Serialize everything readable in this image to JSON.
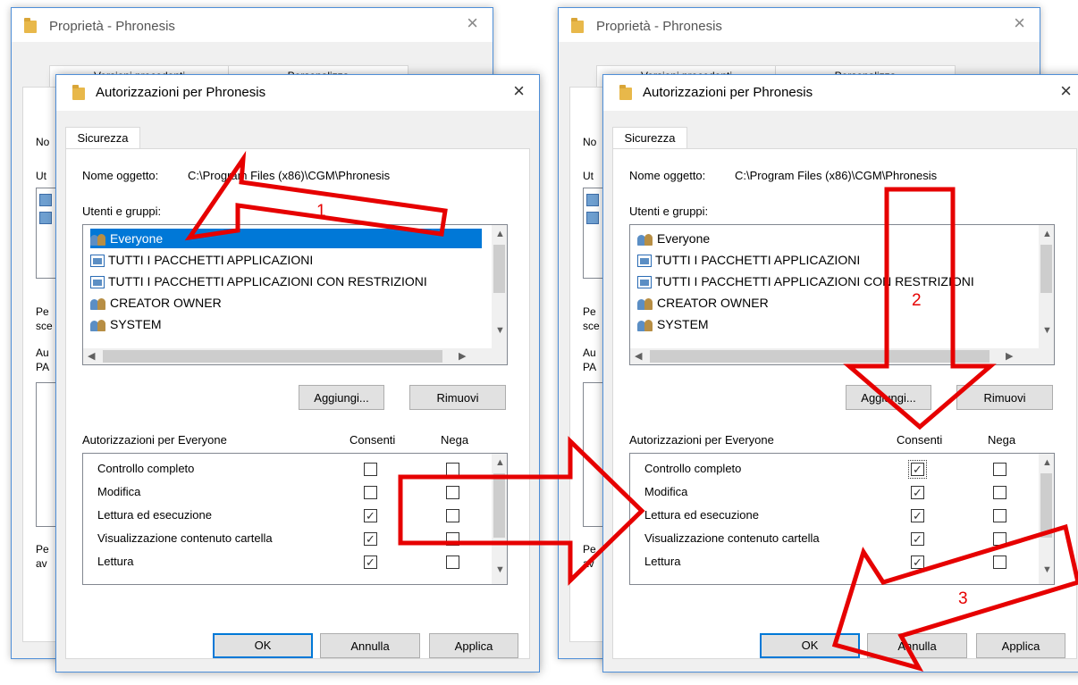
{
  "props_window": {
    "title": "Proprietà - Phronesis",
    "close_glyph": "×",
    "tab_left": "Versioni precedenti",
    "tab_right": "Personalizza",
    "fragments": {
      "nome": "No",
      "utenti": "Ut",
      "per1": "Pe",
      "per1b": "sce",
      "aut": "Au",
      "aut2": "PA",
      "per2": "Pe",
      "per2b": "av"
    }
  },
  "dialog": {
    "title": "Autorizzazioni per Phronesis",
    "close_glyph": "×",
    "tab": "Sicurezza",
    "object_label": "Nome oggetto:",
    "object_value": "C:\\Program Files (x86)\\CGM\\Phronesis",
    "groups_label": "Utenti e gruppi:",
    "users": [
      {
        "name": "Everyone",
        "icon": "people-icon"
      },
      {
        "name": "TUTTI I PACCHETTI APPLICAZIONI",
        "icon": "package-icon"
      },
      {
        "name": "TUTTI I PACCHETTI APPLICAZIONI CON RESTRIZIONI",
        "icon": "package-icon"
      },
      {
        "name": "CREATOR OWNER",
        "icon": "people-icon"
      },
      {
        "name": "SYSTEM",
        "icon": "people-icon"
      }
    ],
    "add_button": "Aggiungi...",
    "remove_button": "Rimuovi",
    "perm_title": "Autorizzazioni per Everyone",
    "allow_header": "Consenti",
    "deny_header": "Nega",
    "permissions": [
      "Controllo completo",
      "Modifica",
      "Lettura ed esecuzione",
      "Visualizzazione contenuto cartella",
      "Lettura"
    ],
    "ok_button": "OK",
    "cancel_button": "Annulla",
    "apply_button": "Applica"
  },
  "state_before": {
    "selected_user": "Everyone",
    "allow": [
      false,
      false,
      true,
      true,
      true
    ],
    "deny": [
      false,
      false,
      false,
      false,
      false
    ]
  },
  "state_after": {
    "selected_user": "",
    "allow": [
      true,
      true,
      true,
      true,
      true
    ],
    "deny": [
      false,
      false,
      false,
      false,
      false
    ]
  },
  "check_glyph": "✓",
  "annotations": {
    "step1": "1",
    "step2": "2",
    "step3": "3",
    "arrow_color": "#e60000"
  }
}
